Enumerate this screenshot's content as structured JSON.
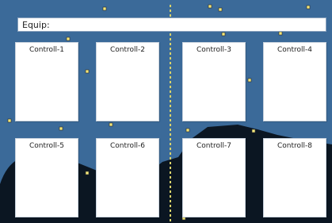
{
  "equip": {
    "label": "Equip:"
  },
  "controls": [
    {
      "label": "Controll-1"
    },
    {
      "label": "Controll-2"
    },
    {
      "label": "Controll-3"
    },
    {
      "label": "Controll-4"
    },
    {
      "label": "Controll-5"
    },
    {
      "label": "Controll-6"
    },
    {
      "label": "Controll-7"
    },
    {
      "label": "Controll-8"
    }
  ],
  "colors": {
    "background": "#3b6a99",
    "terrain": "#0b1622",
    "divider": "#d8d26a",
    "panel": "#ffffff",
    "marker": "#f3e67a"
  }
}
